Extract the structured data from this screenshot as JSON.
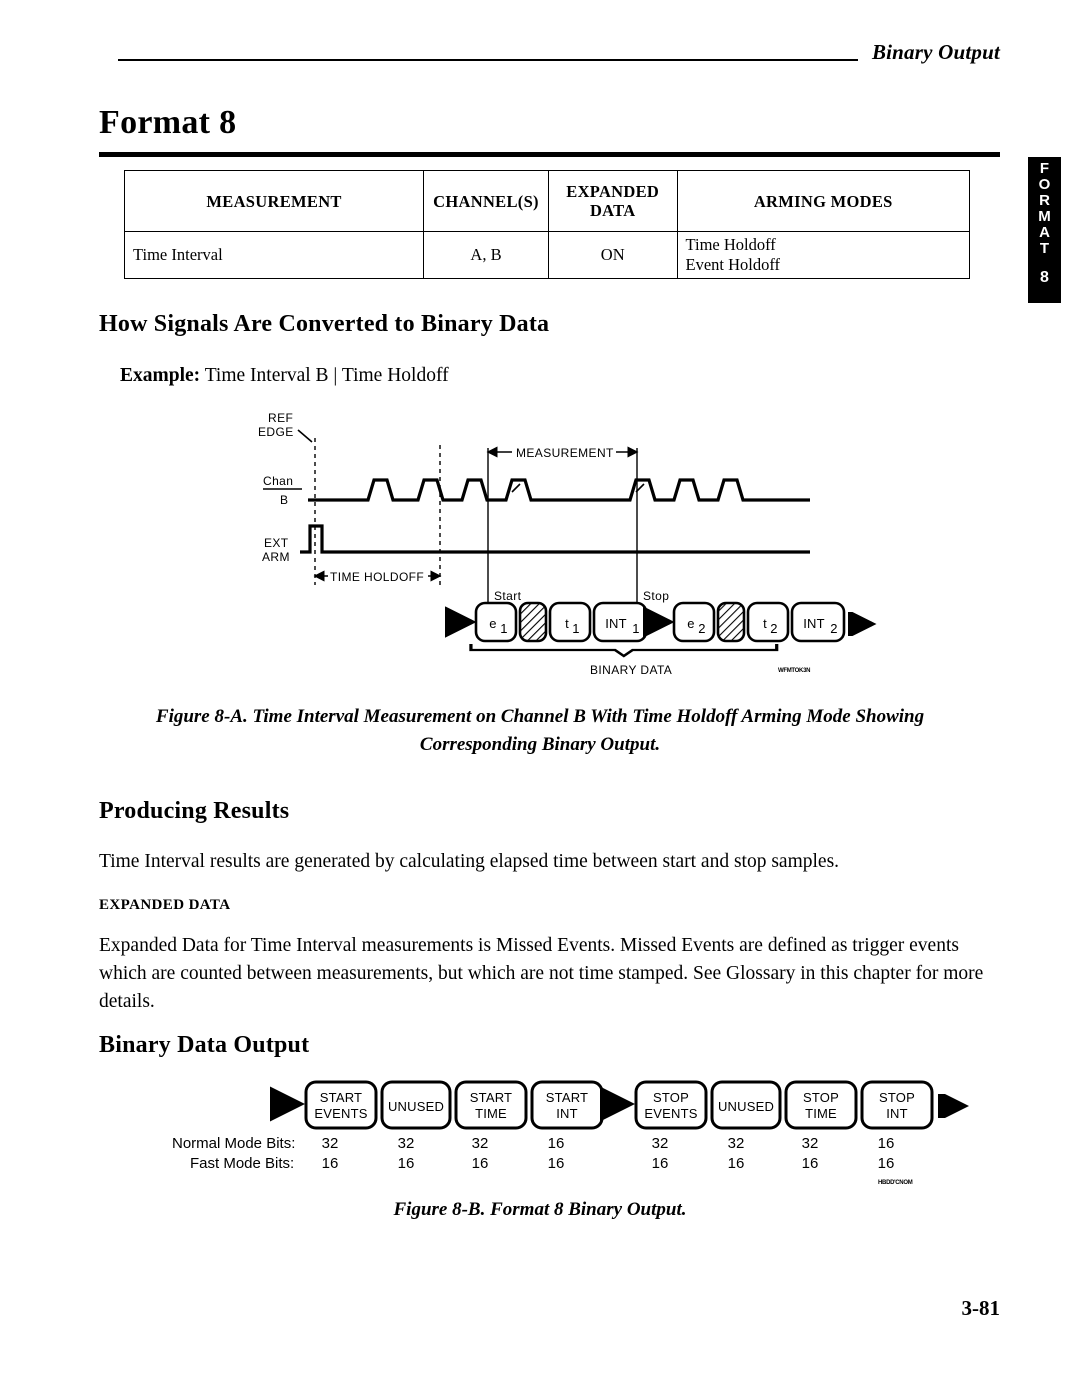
{
  "header": {
    "running_head": "Binary Output"
  },
  "title": "Format 8",
  "side_tab": {
    "letters": [
      "F",
      "O",
      "R",
      "M",
      "A",
      "T"
    ],
    "number": "8"
  },
  "spec_table": {
    "headers": [
      "MEASUREMENT",
      "CHANNEL(S)",
      "EXPANDED DATA",
      "ARMING MODES"
    ],
    "header_lines": {
      "measurement": "MEASUREMENT",
      "channels": "CHANNEL(S)",
      "expanded_1": "EXPANDED",
      "expanded_2": "DATA",
      "arming": "ARMING MODES"
    },
    "rows": [
      {
        "measurement": "Time Interval",
        "channels": "A, B",
        "expanded_data": "ON",
        "arming_modes_1": "Time Holdoff",
        "arming_modes_2": "Event Holdoff"
      }
    ]
  },
  "sections": {
    "how_signals": {
      "heading": "How Signals Are Converted to Binary Data",
      "example_label": "Example:",
      "example_value": "Time Interval B  |  Time Holdoff"
    },
    "producing_results": {
      "heading": "Producing Results",
      "paragraph": "Time Interval results are generated by calculating elapsed time between start and stop samples.",
      "subheading": "EXPANDED DATA",
      "expanded_paragraph": "Expanded Data for Time Interval measurements is Missed Events. Missed Events are defined as trigger events which are counted between measurements, but which are not time stamped. See Glossary in this chapter for more details."
    },
    "binary_data_output": {
      "heading": "Binary Data Output"
    }
  },
  "figure_a": {
    "caption_line1": "Figure 8-A. Time Interval Measurement on Channel B With Time Holdoff Arming Mode Showing",
    "caption_line2": "Corresponding Binary Output.",
    "labels": {
      "ref_edge_1": "REF",
      "ref_edge_2": "EDGE",
      "chan_1": "Chan",
      "chan_2": "B",
      "ext_1": "EXT",
      "ext_2": "ARM",
      "time_holdoff": "TIME HOLDOFF",
      "measurement": "MEASUREMENT",
      "start": "Start",
      "stop": "Stop",
      "binary_data": "BINARY DATA"
    },
    "packet_boxes": [
      {
        "label": "e",
        "sub": "1",
        "hatched": false
      },
      {
        "label": "",
        "sub": "",
        "hatched": true
      },
      {
        "label": "t",
        "sub": "1",
        "hatched": false
      },
      {
        "label": "INT",
        "sub": "1",
        "hatched": false
      },
      {
        "label": "e",
        "sub": "2",
        "hatched": false
      },
      {
        "label": "",
        "sub": "",
        "hatched": true
      },
      {
        "label": "t",
        "sub": "2",
        "hatched": false
      },
      {
        "label": "INT",
        "sub": "2",
        "hatched": false
      }
    ],
    "id_mark": "WFMTOK3N"
  },
  "figure_b": {
    "caption": "Figure 8-B. Format 8 Binary Output.",
    "row_labels": {
      "normal": "Normal Mode Bits:",
      "fast": "Fast Mode Bits:"
    },
    "fields": [
      {
        "line1": "START",
        "line2": "EVENTS",
        "normal_bits": "32",
        "fast_bits": "16"
      },
      {
        "line1": "UNUSED",
        "line2": "",
        "normal_bits": "32",
        "fast_bits": "16"
      },
      {
        "line1": "START",
        "line2": "TIME",
        "normal_bits": "32",
        "fast_bits": "16"
      },
      {
        "line1": "START",
        "line2": "INT",
        "normal_bits": "16",
        "fast_bits": "16"
      },
      {
        "line1": "STOP",
        "line2": "EVENTS",
        "normal_bits": "32",
        "fast_bits": "16"
      },
      {
        "line1": "UNUSED",
        "line2": "",
        "normal_bits": "32",
        "fast_bits": "16"
      },
      {
        "line1": "STOP",
        "line2": "TIME",
        "normal_bits": "32",
        "fast_bits": "16"
      },
      {
        "line1": "STOP",
        "line2": "INT",
        "normal_bits": "16",
        "fast_bits": "16"
      }
    ],
    "id_mark": "HBDD'CNOM"
  },
  "page_number": "3-81"
}
